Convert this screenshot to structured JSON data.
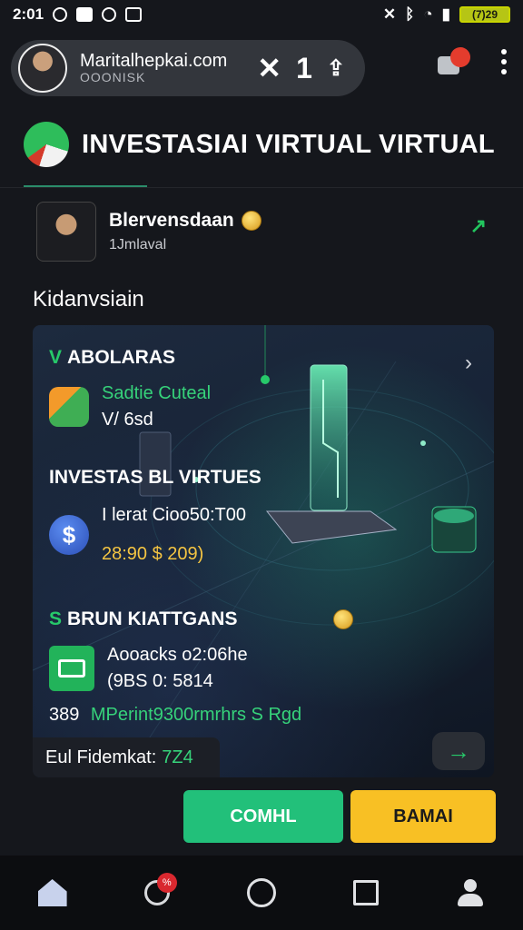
{
  "status_bar": {
    "time": "2:01",
    "battery": "(7)29"
  },
  "browser": {
    "domain": "Maritalhepkai.com",
    "subtitle": "OOONISK",
    "close_label": "✕",
    "tab_count": "1",
    "share_label": "⇪"
  },
  "app": {
    "title": "INVESTASIAI VIRTUAL VIRTUAL"
  },
  "profile": {
    "name": "Blervensdaan",
    "handle": "1Jmlaval"
  },
  "section_label": "Kidanvsiain",
  "card": {
    "section1": {
      "prefix": "V",
      "title": "ABOLARAS",
      "item_title": "Sadtie Cuteal",
      "item_sub": "V/ 6sd"
    },
    "section2": {
      "title": "INVESTAS BL VIRTUES",
      "item_title": "I lerat Cioo50:T00",
      "item_sub": "28:90 $ 209)"
    },
    "section3": {
      "prefix": "S",
      "title": "BRUN KIATTGANS",
      "item_title": "Aooacks o2:06he",
      "item_sub": "(9BS 0: 5814",
      "line_num": "389",
      "line_text": "MPerint9300rmrhrs S Rgd"
    },
    "footer_label": "Eul Fidemkat:",
    "footer_value": "7Z4",
    "go_label": "→"
  },
  "buttons": {
    "primary": "COMHL",
    "secondary": "BAMAI"
  },
  "nav": {
    "badge": "%"
  },
  "colors": {
    "accent_green": "#22c07a",
    "accent_yellow": "#f8c024",
    "background": "#15171c"
  }
}
